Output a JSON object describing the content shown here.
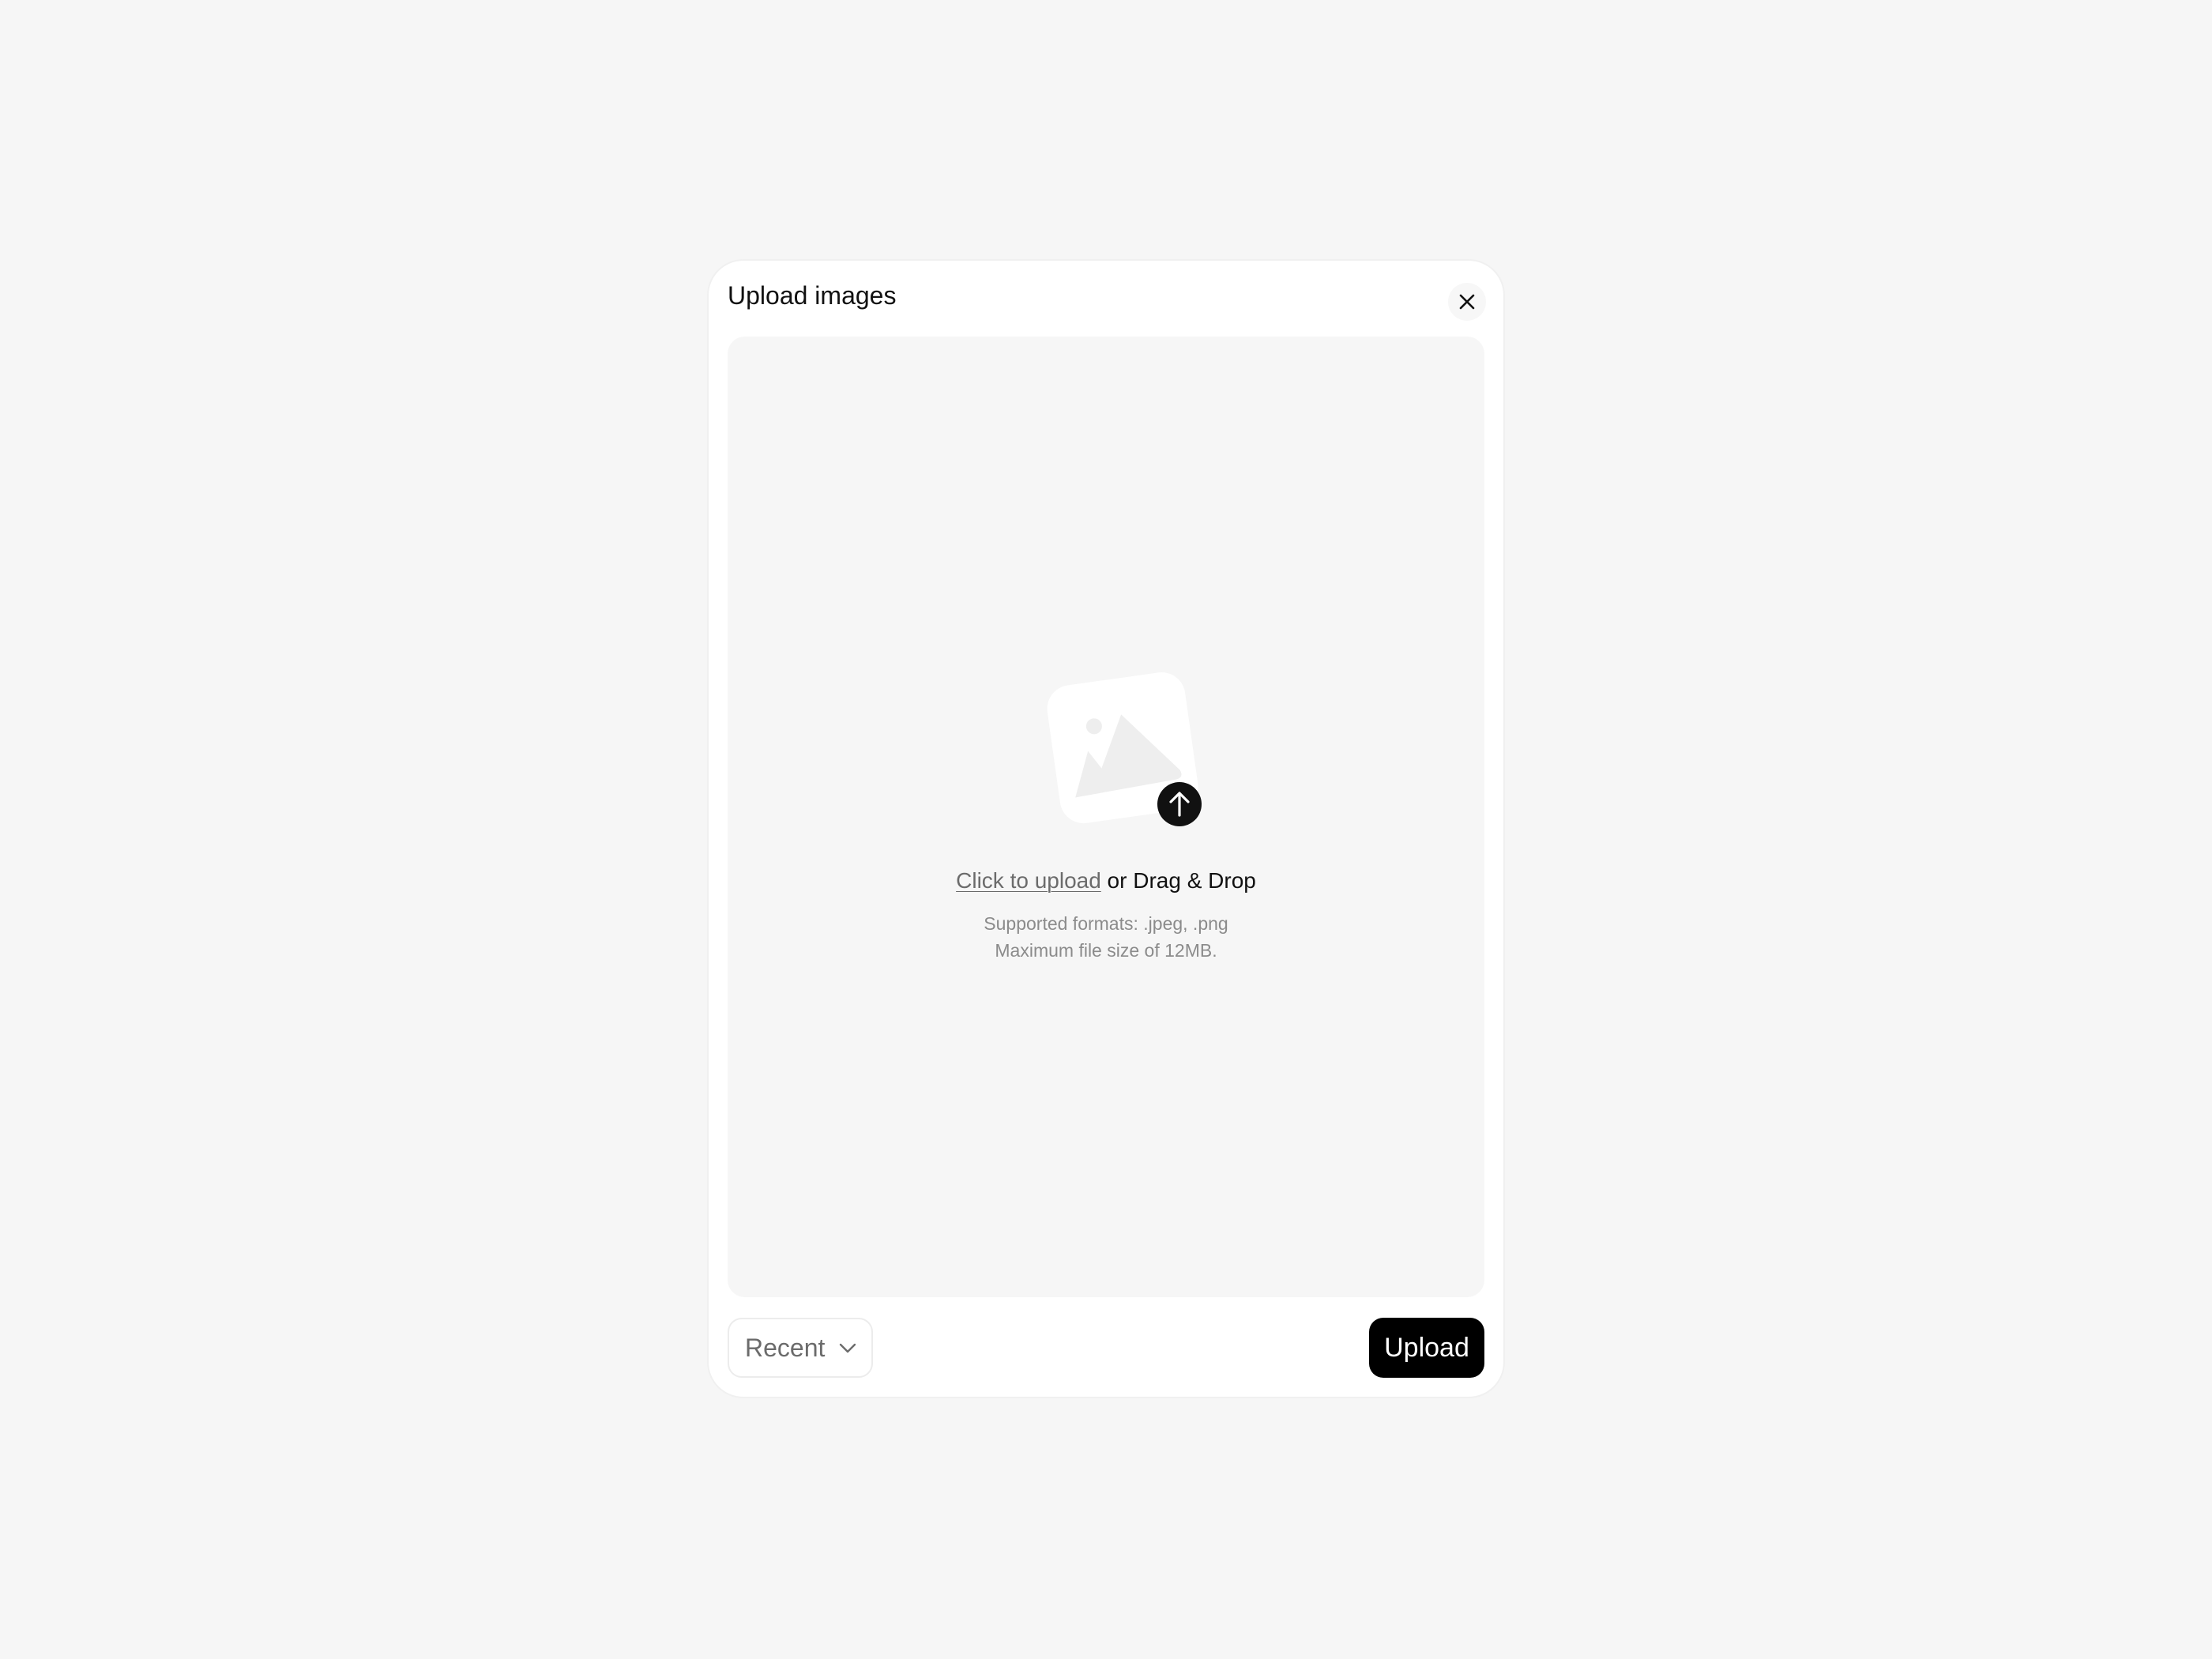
{
  "modal": {
    "title": "Upload images"
  },
  "dropzone": {
    "click_to_upload": "Click to upload",
    "drag_drop": " or Drag & Drop",
    "supported_formats": "Supported formats: .jpeg, .png",
    "max_size": "Maximum file size of 12MB."
  },
  "footer": {
    "sort_selected": "Recent",
    "upload_label": "Upload"
  },
  "icons": {
    "close": "close-icon",
    "image_placeholder": "image-icon",
    "upload_arrow": "arrow-up-icon",
    "dropdown": "chevron-down-icon"
  },
  "colors": {
    "page_background": "#f6f6f6",
    "modal_background": "#ffffff",
    "dropzone_background": "#f6f6f6",
    "primary_button": "#000000",
    "link_text": "#6b6b6b",
    "hint_text": "#8b8b8b"
  }
}
